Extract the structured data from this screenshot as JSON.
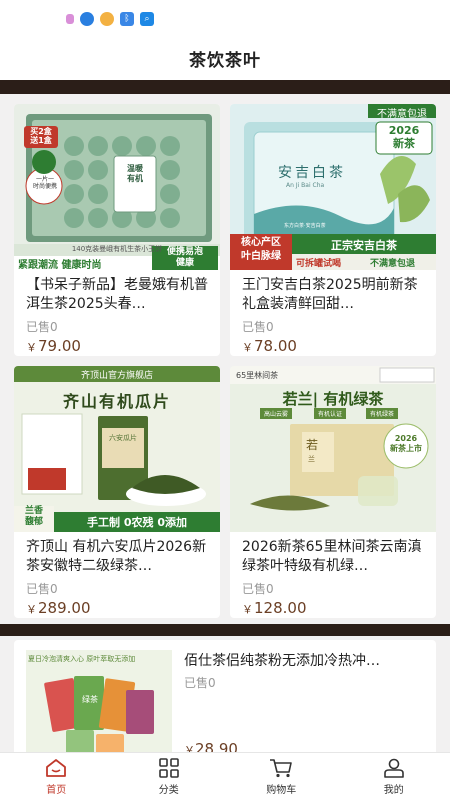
{
  "header": {
    "title": "茶饮茶叶"
  },
  "products": [
    {
      "title": "【书呆子新品】老曼娥有机普洱生茶2025头春…",
      "sold": "已售0",
      "currency": "￥",
      "price": "79.00",
      "image": {
        "promo_tl": "买2盒\n送1盒",
        "caption": "140克装曼峨有机生茶小玉饼",
        "banner_left": "紧跟潮流  健康时尚",
        "banner_right": "便携易泡\n健康",
        "badge": "一片一\n时尚便携",
        "box_label": "温暖\n有机"
      }
    },
    {
      "title": "王门安吉白茶2025明前新茶 礼盒装清鲜回甜…",
      "sold": "已售0",
      "currency": "￥",
      "price": "78.00",
      "image": {
        "top_tag": "不满意包退",
        "year_tag": "2026\n新茶",
        "box_script": "安吉白茶",
        "box_pinyin": "An Ji Bai Cha",
        "box_small": "东方白茶·安吉白茶",
        "left_tag": "核心产区\n叶白脉绿",
        "right_tag": "正宗安吉白茶",
        "bottom_a": "可拆罐试喝",
        "bottom_b": "不满意包退"
      }
    },
    {
      "title": "齐顶山 有机六安瓜片2026新茶安徽特二级绿茶…",
      "sold": "已售0",
      "currency": "￥",
      "price": "289.00",
      "image": {
        "store": "齐顶山官方旗舰店",
        "headline": "齐山有机瓜片",
        "tin_label": "六安瓜片",
        "side_tag": "兰香\n馥郁",
        "bottom": "手工制 0农残 0添加"
      }
    },
    {
      "title": "2026新茶65里林间茶云南滇绿茶叶特级有机绿…",
      "sold": "已售0",
      "currency": "￥",
      "price": "128.00",
      "image": {
        "brand": "65里林间茶",
        "headline": "若兰| 有机绿茶",
        "sub1": "高山云雾",
        "sub2": "有机认证",
        "sub3": "有机绿茶",
        "box_char": "若",
        "box_char2": "兰",
        "year_tag": "2026\n新茶上市"
      }
    }
  ],
  "list_item": {
    "title": "佰仕茶侣纯茶粉无添加冷热冲…",
    "sold": "已售0",
    "currency": "￥",
    "price": "28.90",
    "image": {
      "slogan": "夏日冷泡清爽入心 原叶萃取无添加",
      "pkg": "绿茶"
    }
  },
  "tabbar": [
    {
      "label": "首页",
      "icon": "home-icon",
      "active": true
    },
    {
      "label": "分类",
      "icon": "category-grid-icon",
      "active": false
    },
    {
      "label": "购物车",
      "icon": "cart-icon",
      "active": false
    },
    {
      "label": "我的",
      "icon": "profile-icon",
      "active": false
    }
  ],
  "colors": {
    "price": "#6b3f25",
    "active_tab": "#c0392b",
    "band": "#2b1e18"
  }
}
